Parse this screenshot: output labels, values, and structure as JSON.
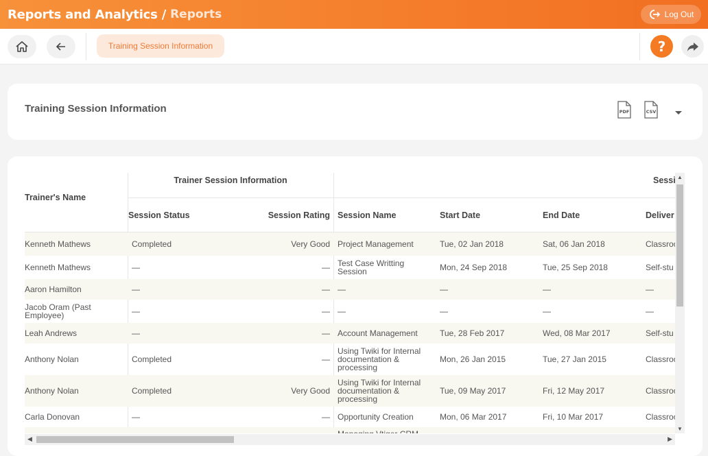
{
  "header": {
    "title": "Reports and Analytics /",
    "subtitle": "Reports",
    "logout_label": "Log Out"
  },
  "toolbar": {
    "breadcrumb": "Training Session Information",
    "help_label": "?"
  },
  "card": {
    "title": "Training Session Information",
    "pdf_label": "PDF",
    "csv_label": "CSV"
  },
  "table": {
    "group_headers": {
      "trainer_session": "Trainer Session Information",
      "session": "Sessi"
    },
    "columns": [
      "Trainer's Name",
      "Session Status",
      "Session Rating",
      "Session Name",
      "Start Date",
      "End Date",
      "Deliver"
    ],
    "rows": [
      [
        "Kenneth Mathews",
        "Completed",
        "Very Good",
        "Project Management",
        "Tue, 02 Jan 2018",
        "Sat, 06 Jan 2018",
        "Classroo"
      ],
      [
        "Kenneth Mathews",
        "—",
        "—",
        "Test Case Writting Session",
        "Mon, 24 Sep 2018",
        "Tue, 25 Sep 2018",
        "Self-stu"
      ],
      [
        "Aaron Hamilton",
        "—",
        "—",
        "—",
        "—",
        "—",
        "—"
      ],
      [
        "Jacob Oram (Past Employee)",
        "—",
        "—",
        "—",
        "—",
        "—",
        "—"
      ],
      [
        "Leah Andrews",
        "—",
        "—",
        "Account Management",
        "Tue, 28 Feb 2017",
        "Wed, 08 Mar 2017",
        "Self-stu"
      ],
      [
        "Anthony Nolan",
        "Completed",
        "—",
        "Using Twiki for Internal documentation & processing",
        "Mon, 26 Jan 2015",
        "Tue, 27 Jan 2015",
        "Classroo"
      ],
      [
        "Anthony Nolan",
        "Completed",
        "Very Good",
        "Using Twiki for Internal documentation & processing",
        "Tue, 09 May 2017",
        "Fri, 12 May 2017",
        "Classroo"
      ],
      [
        "Carla Donovan",
        "—",
        "—",
        "Opportunity Creation",
        "Mon, 06 Mar 2017",
        "Fri, 10 Mar 2017",
        "Classroo"
      ],
      [
        "",
        "",
        "",
        "Managing Vtiger CRM",
        "",
        "",
        ""
      ]
    ]
  },
  "colors": {
    "brand_orange": "#f47b24",
    "pill_bg": "#fde8dc",
    "row_alt": "#f8f7f0"
  },
  "icons": [
    "logout-icon",
    "home-icon",
    "back-arrow-icon",
    "help-icon",
    "share-icon",
    "pdf-file-icon",
    "csv-file-icon",
    "caret-down-icon"
  ]
}
